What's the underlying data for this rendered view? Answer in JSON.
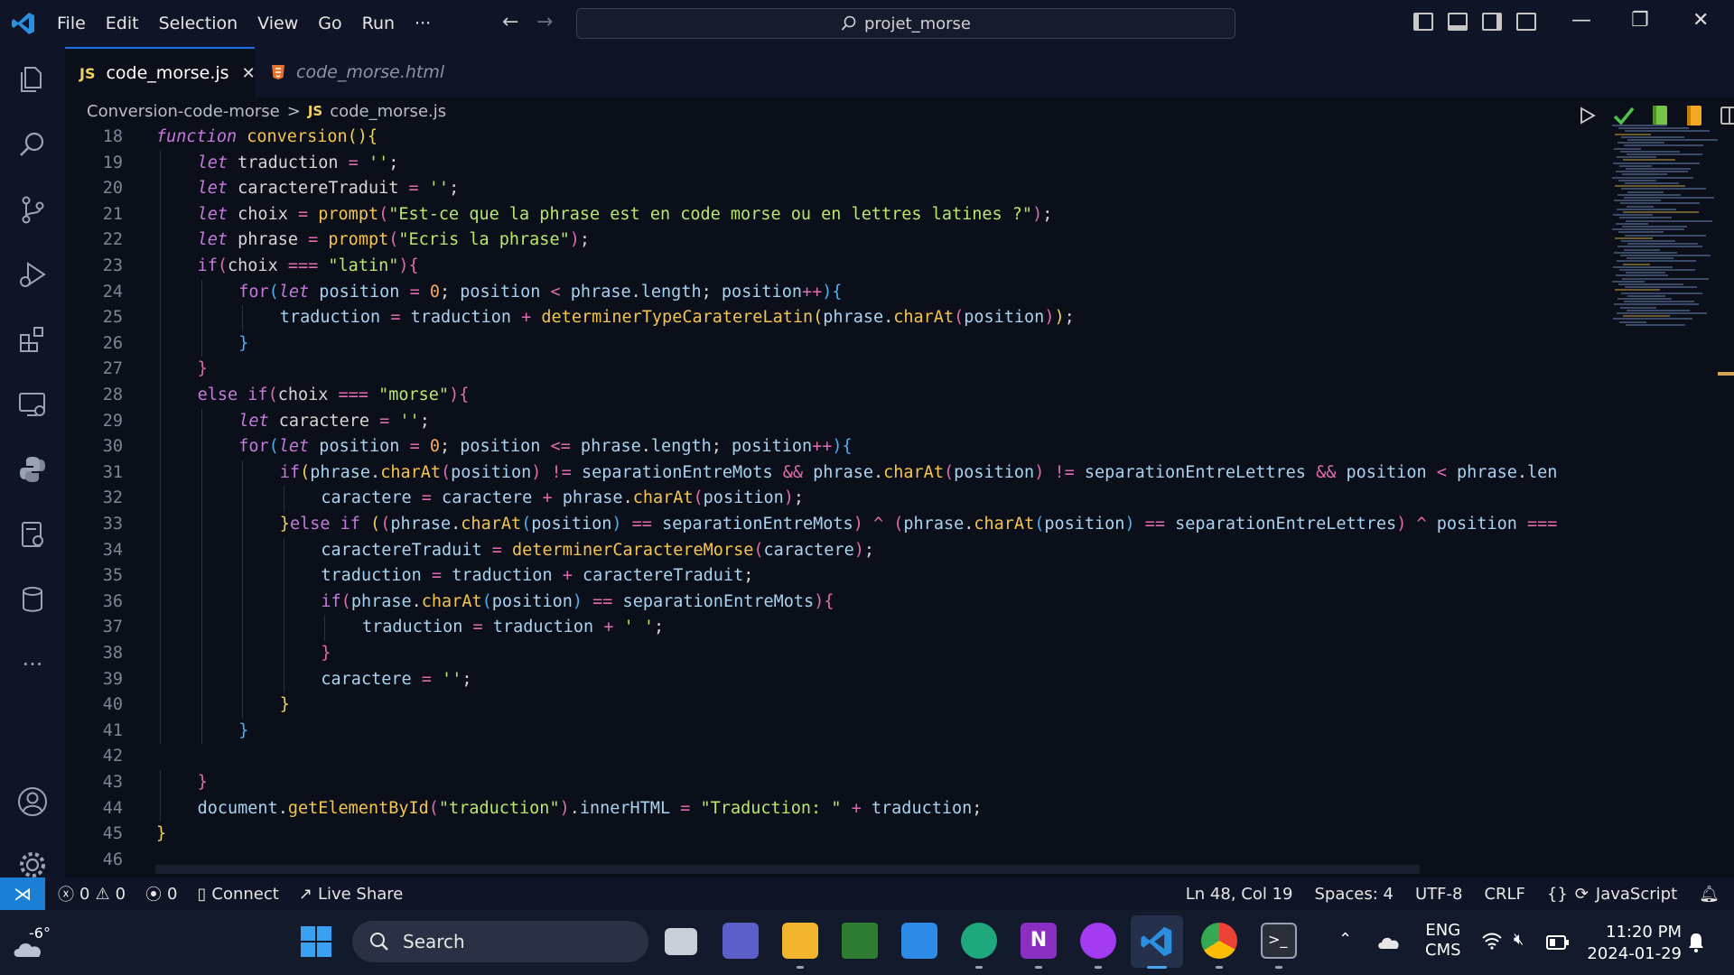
{
  "menu": [
    "File",
    "Edit",
    "Selection",
    "View",
    "Go",
    "Run",
    "···"
  ],
  "search": {
    "text": "projet_morse"
  },
  "tabs": [
    {
      "icon": "JS",
      "label": "code_morse.js",
      "active": true,
      "close": "✕"
    },
    {
      "icon": "html-icon",
      "label": "code_morse.html",
      "active": false
    }
  ],
  "breadcrumb": {
    "folder": "Conversion-code-morse",
    "separator": ">",
    "icon": "JS",
    "file": "code_morse.js"
  },
  "editor": {
    "lines": [
      {
        "n": "18",
        "indent": 0,
        "tokens": [
          [
            "kw",
            "function"
          ],
          [
            "obj",
            " "
          ],
          [
            "fn",
            "conversion"
          ],
          [
            "br1",
            "()"
          ],
          [
            "br1",
            "{"
          ]
        ]
      },
      {
        "n": "19",
        "indent": 1,
        "tokens": [
          [
            "kw",
            "let"
          ],
          [
            "obj",
            " traduction "
          ],
          [
            "op",
            "="
          ],
          [
            "str",
            " ''"
          ],
          [
            "obj",
            ";"
          ]
        ]
      },
      {
        "n": "20",
        "indent": 1,
        "tokens": [
          [
            "kw",
            "let"
          ],
          [
            "obj",
            " caractereTraduit "
          ],
          [
            "op",
            "="
          ],
          [
            "str",
            " ''"
          ],
          [
            "obj",
            ";"
          ]
        ]
      },
      {
        "n": "21",
        "indent": 1,
        "tokens": [
          [
            "kw",
            "let"
          ],
          [
            "obj",
            " choix "
          ],
          [
            "op",
            "="
          ],
          [
            "fn",
            " prompt"
          ],
          [
            "br2",
            "("
          ],
          [
            "str",
            "\"Est-ce que la phrase est en code morse ou en lettres latines ?\""
          ],
          [
            "br2",
            ")"
          ],
          [
            "obj",
            ";"
          ]
        ]
      },
      {
        "n": "22",
        "indent": 1,
        "tokens": [
          [
            "kw",
            "let"
          ],
          [
            "obj",
            " phrase "
          ],
          [
            "op",
            "="
          ],
          [
            "fn",
            " prompt"
          ],
          [
            "br2",
            "("
          ],
          [
            "str",
            "\"Ecris la phrase\""
          ],
          [
            "br2",
            ")"
          ],
          [
            "obj",
            ";"
          ]
        ]
      },
      {
        "n": "23",
        "indent": 1,
        "tokens": [
          [
            "ctl",
            "if"
          ],
          [
            "br2",
            "("
          ],
          [
            "obj",
            "choix "
          ],
          [
            "op",
            "==="
          ],
          [
            "str",
            " \"latin\""
          ],
          [
            "br2",
            ")"
          ],
          [
            "br2",
            "{"
          ]
        ]
      },
      {
        "n": "24",
        "indent": 2,
        "tokens": [
          [
            "ctl",
            "for"
          ],
          [
            "br3",
            "("
          ],
          [
            "kw",
            "let"
          ],
          [
            "var",
            " position "
          ],
          [
            "op",
            "="
          ],
          [
            "num",
            " 0"
          ],
          [
            "obj",
            "; "
          ],
          [
            "var",
            "position "
          ],
          [
            "op",
            "<"
          ],
          [
            "var",
            " phrase"
          ],
          [
            "obj",
            "."
          ],
          [
            "var",
            "length"
          ],
          [
            "obj",
            "; "
          ],
          [
            "var",
            "position"
          ],
          [
            "op",
            "++"
          ],
          [
            "br3",
            ")"
          ],
          [
            "br3",
            "{"
          ]
        ]
      },
      {
        "n": "25",
        "indent": 3,
        "tokens": [
          [
            "var",
            "traduction "
          ],
          [
            "op",
            "="
          ],
          [
            "var",
            " traduction "
          ],
          [
            "op",
            "+"
          ],
          [
            "fn",
            " determinerTypeCaratereLatin"
          ],
          [
            "br1",
            "("
          ],
          [
            "var",
            "phrase"
          ],
          [
            "obj",
            "."
          ],
          [
            "fn",
            "charAt"
          ],
          [
            "br2",
            "("
          ],
          [
            "var",
            "position"
          ],
          [
            "br2",
            ")"
          ],
          [
            "br1",
            ")"
          ],
          [
            "obj",
            ";"
          ]
        ]
      },
      {
        "n": "26",
        "indent": 2,
        "tokens": [
          [
            "br3",
            "}"
          ]
        ]
      },
      {
        "n": "27",
        "indent": 1,
        "tokens": [
          [
            "br2",
            "}"
          ]
        ]
      },
      {
        "n": "28",
        "indent": 1,
        "tokens": [
          [
            "ctl",
            "else if"
          ],
          [
            "br2",
            "("
          ],
          [
            "obj",
            "choix "
          ],
          [
            "op",
            "==="
          ],
          [
            "str",
            " \"morse\""
          ],
          [
            "br2",
            ")"
          ],
          [
            "br2",
            "{"
          ]
        ]
      },
      {
        "n": "29",
        "indent": 2,
        "tokens": [
          [
            "kw",
            "let"
          ],
          [
            "obj",
            " caractere "
          ],
          [
            "op",
            "="
          ],
          [
            "str",
            " ''"
          ],
          [
            "obj",
            ";"
          ]
        ]
      },
      {
        "n": "30",
        "indent": 2,
        "tokens": [
          [
            "ctl",
            "for"
          ],
          [
            "br3",
            "("
          ],
          [
            "kw",
            "let"
          ],
          [
            "var",
            " position "
          ],
          [
            "op",
            "="
          ],
          [
            "num",
            " 0"
          ],
          [
            "obj",
            "; "
          ],
          [
            "var",
            "position "
          ],
          [
            "op",
            "<="
          ],
          [
            "var",
            " phrase"
          ],
          [
            "obj",
            "."
          ],
          [
            "var",
            "length"
          ],
          [
            "obj",
            "; "
          ],
          [
            "var",
            "position"
          ],
          [
            "op",
            "++"
          ],
          [
            "br3",
            ")"
          ],
          [
            "br3",
            "{"
          ]
        ]
      },
      {
        "n": "31",
        "indent": 3,
        "tokens": [
          [
            "ctl",
            "if"
          ],
          [
            "br1",
            "("
          ],
          [
            "var",
            "phrase"
          ],
          [
            "obj",
            "."
          ],
          [
            "fn",
            "charAt"
          ],
          [
            "br2",
            "("
          ],
          [
            "var",
            "position"
          ],
          [
            "br2",
            ")"
          ],
          [
            "op",
            " !="
          ],
          [
            "var",
            " separationEntreMots "
          ],
          [
            "op",
            "&&"
          ],
          [
            "var",
            " phrase"
          ],
          [
            "obj",
            "."
          ],
          [
            "fn",
            "charAt"
          ],
          [
            "br2",
            "("
          ],
          [
            "var",
            "position"
          ],
          [
            "br2",
            ")"
          ],
          [
            "op",
            " !="
          ],
          [
            "var",
            " separationEntreLettres "
          ],
          [
            "op",
            "&&"
          ],
          [
            "var",
            " position "
          ],
          [
            "op",
            "<"
          ],
          [
            "var",
            " phrase"
          ],
          [
            "obj",
            "."
          ],
          [
            "var",
            "len"
          ]
        ]
      },
      {
        "n": "32",
        "indent": 4,
        "tokens": [
          [
            "var",
            "caractere "
          ],
          [
            "op",
            "="
          ],
          [
            "var",
            " caractere "
          ],
          [
            "op",
            "+"
          ],
          [
            "var",
            " phrase"
          ],
          [
            "obj",
            "."
          ],
          [
            "fn",
            "charAt"
          ],
          [
            "br2",
            "("
          ],
          [
            "var",
            "position"
          ],
          [
            "br2",
            ")"
          ],
          [
            "obj",
            ";"
          ]
        ]
      },
      {
        "n": "33",
        "indent": 3,
        "tokens": [
          [
            "br1",
            "}"
          ],
          [
            "ctl",
            "else if"
          ],
          [
            "obj",
            " "
          ],
          [
            "br1",
            "("
          ],
          [
            "br2",
            "("
          ],
          [
            "var",
            "phrase"
          ],
          [
            "obj",
            "."
          ],
          [
            "fn",
            "charAt"
          ],
          [
            "br3",
            "("
          ],
          [
            "var",
            "position"
          ],
          [
            "br3",
            ")"
          ],
          [
            "op",
            " =="
          ],
          [
            "var",
            " separationEntreMots"
          ],
          [
            "br2",
            ")"
          ],
          [
            "op",
            " ^"
          ],
          [
            "obj",
            " "
          ],
          [
            "br2",
            "("
          ],
          [
            "var",
            "phrase"
          ],
          [
            "obj",
            "."
          ],
          [
            "fn",
            "charAt"
          ],
          [
            "br3",
            "("
          ],
          [
            "var",
            "position"
          ],
          [
            "br3",
            ")"
          ],
          [
            "op",
            " =="
          ],
          [
            "var",
            " separationEntreLettres"
          ],
          [
            "br2",
            ")"
          ],
          [
            "op",
            " ^"
          ],
          [
            "var",
            " position "
          ],
          [
            "op",
            "==="
          ]
        ]
      },
      {
        "n": "34",
        "indent": 4,
        "tokens": [
          [
            "var",
            "caractereTraduit "
          ],
          [
            "op",
            "="
          ],
          [
            "fn",
            " determinerCaractereMorse"
          ],
          [
            "br2",
            "("
          ],
          [
            "var",
            "caractere"
          ],
          [
            "br2",
            ")"
          ],
          [
            "obj",
            ";"
          ]
        ]
      },
      {
        "n": "35",
        "indent": 4,
        "tokens": [
          [
            "var",
            "traduction "
          ],
          [
            "op",
            "="
          ],
          [
            "var",
            " traduction "
          ],
          [
            "op",
            "+"
          ],
          [
            "var",
            " caractereTraduit"
          ],
          [
            "obj",
            ";"
          ]
        ]
      },
      {
        "n": "36",
        "indent": 4,
        "tokens": [
          [
            "ctl",
            "if"
          ],
          [
            "br2",
            "("
          ],
          [
            "var",
            "phrase"
          ],
          [
            "obj",
            "."
          ],
          [
            "fn",
            "charAt"
          ],
          [
            "br3",
            "("
          ],
          [
            "var",
            "position"
          ],
          [
            "br3",
            ")"
          ],
          [
            "op",
            " =="
          ],
          [
            "var",
            " separationEntreMots"
          ],
          [
            "br2",
            ")"
          ],
          [
            "br2",
            "{"
          ]
        ]
      },
      {
        "n": "37",
        "indent": 5,
        "tokens": [
          [
            "var",
            "traduction "
          ],
          [
            "op",
            "="
          ],
          [
            "var",
            " traduction "
          ],
          [
            "op",
            "+"
          ],
          [
            "str",
            " ' '"
          ],
          [
            "obj",
            ";"
          ]
        ]
      },
      {
        "n": "38",
        "indent": 4,
        "tokens": [
          [
            "br2",
            "}"
          ]
        ]
      },
      {
        "n": "39",
        "indent": 4,
        "tokens": [
          [
            "var",
            "caractere "
          ],
          [
            "op",
            "="
          ],
          [
            "str",
            " ''"
          ],
          [
            "obj",
            ";"
          ]
        ]
      },
      {
        "n": "40",
        "indent": 3,
        "tokens": [
          [
            "br1",
            "}"
          ]
        ]
      },
      {
        "n": "41",
        "indent": 2,
        "tokens": [
          [
            "br3",
            "}"
          ]
        ]
      },
      {
        "n": "42",
        "indent": 0,
        "tokens": []
      },
      {
        "n": "43",
        "indent": 1,
        "tokens": [
          [
            "br2",
            "}"
          ]
        ]
      },
      {
        "n": "44",
        "indent": 1,
        "tokens": [
          [
            "var",
            "document"
          ],
          [
            "obj",
            "."
          ],
          [
            "fn",
            "getElementById"
          ],
          [
            "br2",
            "("
          ],
          [
            "str",
            "\"traduction\""
          ],
          [
            "br2",
            ")"
          ],
          [
            "obj",
            "."
          ],
          [
            "var",
            "innerHTML "
          ],
          [
            "op",
            "="
          ],
          [
            "str",
            " \"Traduction: \""
          ],
          [
            "op",
            " +"
          ],
          [
            "var",
            " traduction"
          ],
          [
            "obj",
            ";"
          ]
        ]
      },
      {
        "n": "45",
        "indent": 0,
        "tokens": [
          [
            "br1",
            "}"
          ]
        ]
      },
      {
        "n": "46",
        "indent": 0,
        "tokens": []
      }
    ]
  },
  "statusbar": {
    "errors": "0",
    "warnings": "0",
    "ports": "0",
    "connect": "Connect",
    "liveshare": "Live Share",
    "cursor": "Ln 48, Col 19",
    "spaces": "Spaces: 4",
    "encoding": "UTF-8",
    "eol": "CRLF",
    "language": "JavaScript"
  },
  "taskbar": {
    "weather": "-6°",
    "search": "Search",
    "lang1": "ENG",
    "lang2": "CMS",
    "time": "11:20 PM",
    "date": "2024-01-29"
  },
  "colors": {
    "accent": "#1f6feb",
    "remote": "#1c7fd6",
    "keyword": "#c678dd",
    "function": "#f5c44e",
    "string": "#b9e66c"
  }
}
